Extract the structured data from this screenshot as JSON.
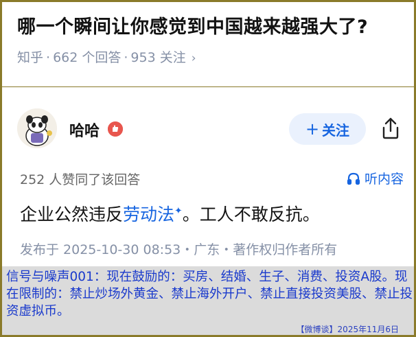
{
  "question": {
    "title": "哪一个瞬间让你感觉到中国越来越强大了?",
    "source": "知乎",
    "answers_count": "662 个回答",
    "followers_count": "953 关注",
    "chevron": "›"
  },
  "author": {
    "name": "哈哈",
    "avatar_icon": "avatar-image",
    "badge_icon": "hand-badge-icon"
  },
  "actions": {
    "follow_label": "关注",
    "follow_plus": "+",
    "share_icon": "share-icon"
  },
  "answer": {
    "likes_text": "252 人赞同了该回答",
    "listen_label": "听内容",
    "content_before": "企业公然违反",
    "content_link": "劳动法",
    "content_after": "。工人不敢反抗。",
    "publish_info": "发布于 2025-10-30 08:53・广东・著作权归作者所有"
  },
  "overlay": {
    "text": "信号与噪声001：现在鼓励的：买房、结婚、生子、消费、投资A股。现在限制的：禁止炒场外黄金、禁止海外开户、禁止直接投资美股、禁止投资虚拟币。",
    "footer": "【微博谈】2025年11月6日"
  },
  "colors": {
    "accent": "#1765e0",
    "frame": "#8a7a2a",
    "overlay_text": "#1a3acc"
  }
}
